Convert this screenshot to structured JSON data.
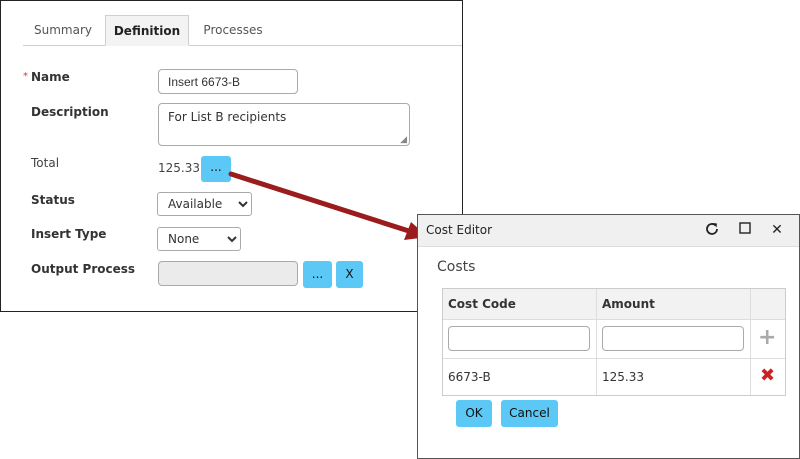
{
  "tabs": [
    "Summary",
    "Definition",
    "Processes"
  ],
  "form": {
    "required_mark": "*",
    "name_label": "Name",
    "name_value": "Insert 6673-B",
    "description_label": "Description",
    "description_value": "For List B recipients",
    "total_label": "Total",
    "total_value": "125.33",
    "ellipsis_label": "...",
    "status_label": "Status",
    "status_value": "Available",
    "insert_type_label": "Insert Type",
    "insert_type_value": "None",
    "output_process_label": "Output Process",
    "output_process_value": "",
    "clear_label": "X"
  },
  "dialog": {
    "title": "Cost Editor",
    "section_title": "Costs",
    "columns": [
      "Cost Code",
      "Amount"
    ],
    "new_cost_code": "",
    "new_amount": "",
    "rows": [
      {
        "code": "6673-B",
        "amount": "125.33"
      }
    ],
    "ok_label": "OK",
    "cancel_label": "Cancel"
  },
  "colors": {
    "button": "#5bc8f5",
    "arrow": "#9b1c1c",
    "delete": "#cc2222"
  }
}
